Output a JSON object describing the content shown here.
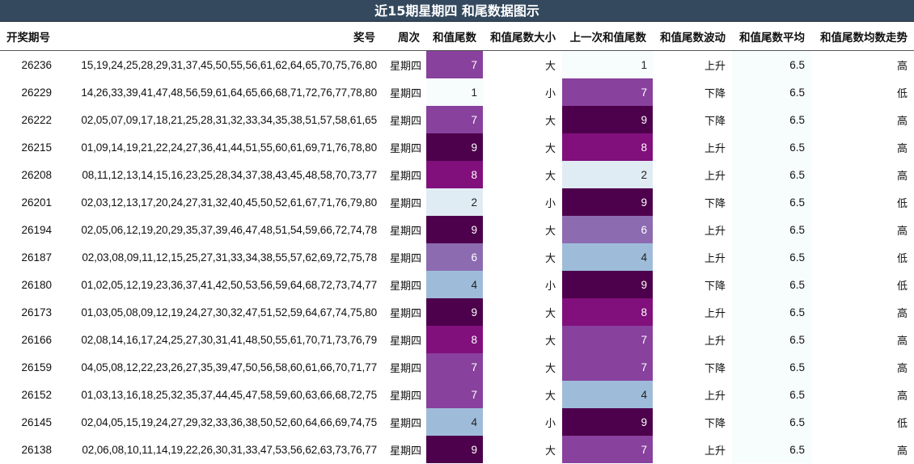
{
  "title": "近15期星期四 和尾数据图示",
  "columns": [
    "开奖期号",
    "奖号",
    "周次",
    "和值尾数",
    "和值尾数大小",
    "上一次和值尾数",
    "和值尾数波动",
    "和值尾数平均",
    "和值尾数均数走势"
  ],
  "colors": {
    "header_bg": "#34495e",
    "scale": {
      "0": "#f7fcfd",
      "1": "#f7fcfd",
      "2": "#e0ecf4",
      "3": "#bfd3e6",
      "4": "#9ebcda",
      "5": "#8c96c6",
      "6": "#8c6bb1",
      "7": "#88419d",
      "8": "#810f7c",
      "9": "#4d004b"
    }
  },
  "chart_data": {
    "type": "table",
    "title": "近15期星期四 和尾数据图示",
    "columns": [
      "开奖期号",
      "奖号",
      "周次",
      "和值尾数",
      "和值尾数大小",
      "上一次和值尾数",
      "和值尾数波动",
      "和值尾数平均",
      "和值尾数均数走势"
    ],
    "rows": [
      {
        "issue": "26236",
        "numbers": "15,19,24,25,28,29,31,37,45,50,55,56,61,62,64,65,70,75,76,80",
        "weekday": "星期四",
        "tail": 7,
        "size": "大",
        "prev_tail": 1,
        "direction": "上升",
        "avg": "6.5",
        "trend": "高"
      },
      {
        "issue": "26229",
        "numbers": "14,26,33,39,41,47,48,56,59,61,64,65,66,68,71,72,76,77,78,80",
        "weekday": "星期四",
        "tail": 1,
        "size": "小",
        "prev_tail": 7,
        "direction": "下降",
        "avg": "6.5",
        "trend": "低"
      },
      {
        "issue": "26222",
        "numbers": "02,05,07,09,17,18,21,25,28,31,32,33,34,35,38,51,57,58,61,65",
        "weekday": "星期四",
        "tail": 7,
        "size": "大",
        "prev_tail": 9,
        "direction": "下降",
        "avg": "6.5",
        "trend": "高"
      },
      {
        "issue": "26215",
        "numbers": "01,09,14,19,21,22,24,27,36,41,44,51,55,60,61,69,71,76,78,80",
        "weekday": "星期四",
        "tail": 9,
        "size": "大",
        "prev_tail": 8,
        "direction": "上升",
        "avg": "6.5",
        "trend": "高"
      },
      {
        "issue": "26208",
        "numbers": "08,11,12,13,14,15,16,23,25,28,34,37,38,43,45,48,58,70,73,77",
        "weekday": "星期四",
        "tail": 8,
        "size": "大",
        "prev_tail": 2,
        "direction": "上升",
        "avg": "6.5",
        "trend": "高"
      },
      {
        "issue": "26201",
        "numbers": "02,03,12,13,17,20,24,27,31,32,40,45,50,52,61,67,71,76,79,80",
        "weekday": "星期四",
        "tail": 2,
        "size": "小",
        "prev_tail": 9,
        "direction": "下降",
        "avg": "6.5",
        "trend": "低"
      },
      {
        "issue": "26194",
        "numbers": "02,05,06,12,19,20,29,35,37,39,46,47,48,51,54,59,66,72,74,78",
        "weekday": "星期四",
        "tail": 9,
        "size": "大",
        "prev_tail": 6,
        "direction": "上升",
        "avg": "6.5",
        "trend": "高"
      },
      {
        "issue": "26187",
        "numbers": "02,03,08,09,11,12,15,25,27,31,33,34,38,55,57,62,69,72,75,78",
        "weekday": "星期四",
        "tail": 6,
        "size": "大",
        "prev_tail": 4,
        "direction": "上升",
        "avg": "6.5",
        "trend": "低"
      },
      {
        "issue": "26180",
        "numbers": "01,02,05,12,19,23,36,37,41,42,50,53,56,59,64,68,72,73,74,77",
        "weekday": "星期四",
        "tail": 4,
        "size": "小",
        "prev_tail": 9,
        "direction": "下降",
        "avg": "6.5",
        "trend": "低"
      },
      {
        "issue": "26173",
        "numbers": "01,03,05,08,09,12,19,24,27,30,32,47,51,52,59,64,67,74,75,80",
        "weekday": "星期四",
        "tail": 9,
        "size": "大",
        "prev_tail": 8,
        "direction": "上升",
        "avg": "6.5",
        "trend": "高"
      },
      {
        "issue": "26166",
        "numbers": "02,08,14,16,17,24,25,27,30,31,41,48,50,55,61,70,71,73,76,79",
        "weekday": "星期四",
        "tail": 8,
        "size": "大",
        "prev_tail": 7,
        "direction": "上升",
        "avg": "6.5",
        "trend": "高"
      },
      {
        "issue": "26159",
        "numbers": "04,05,08,12,22,23,26,27,35,39,47,50,56,58,60,61,66,70,71,77",
        "weekday": "星期四",
        "tail": 7,
        "size": "大",
        "prev_tail": 7,
        "direction": "下降",
        "avg": "6.5",
        "trend": "高"
      },
      {
        "issue": "26152",
        "numbers": "01,03,13,16,18,25,32,35,37,44,45,47,58,59,60,63,66,68,72,75",
        "weekday": "星期四",
        "tail": 7,
        "size": "大",
        "prev_tail": 4,
        "direction": "上升",
        "avg": "6.5",
        "trend": "高"
      },
      {
        "issue": "26145",
        "numbers": "02,04,05,15,19,24,27,29,32,33,36,38,50,52,60,64,66,69,74,75",
        "weekday": "星期四",
        "tail": 4,
        "size": "小",
        "prev_tail": 9,
        "direction": "下降",
        "avg": "6.5",
        "trend": "低"
      },
      {
        "issue": "26138",
        "numbers": "02,06,08,10,11,14,19,22,26,30,31,33,47,53,56,62,63,73,76,77",
        "weekday": "星期四",
        "tail": 9,
        "size": "大",
        "prev_tail": 7,
        "direction": "上升",
        "avg": "6.5",
        "trend": "高"
      }
    ]
  }
}
